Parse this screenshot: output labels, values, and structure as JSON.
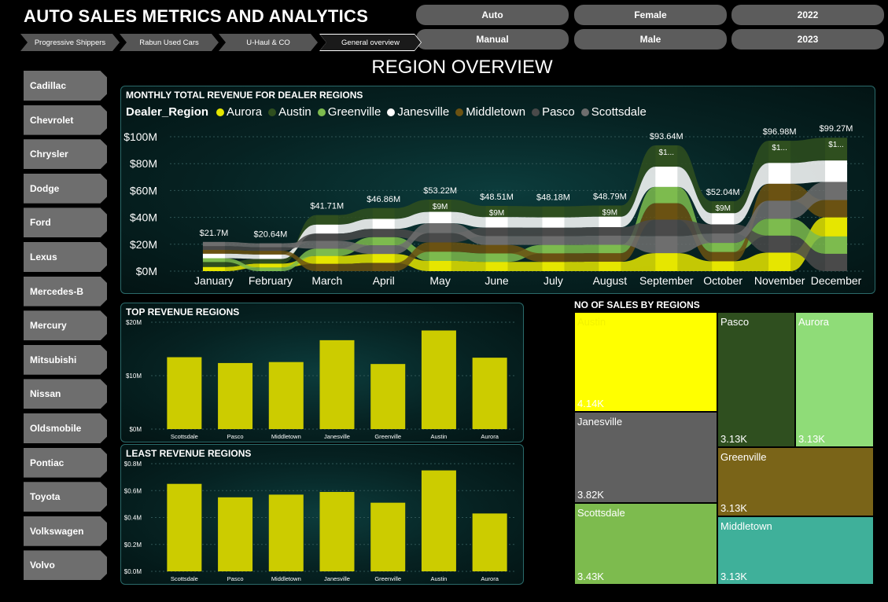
{
  "header": {
    "title": "AUTO SALES METRICS AND ANALYTICS",
    "section_title": "REGION OVERVIEW"
  },
  "filters": {
    "row1": [
      "Auto",
      "Female",
      "2022"
    ],
    "row2": [
      "Manual",
      "Male",
      "2023"
    ]
  },
  "breadcrumbs": [
    "Progressive Shippers",
    "Rabun Used Cars",
    "U-Haul & CO",
    "General overview"
  ],
  "brands": [
    "Cadillac",
    "Chevrolet",
    "Chrysler",
    "Dodge",
    "Ford",
    "Lexus",
    "Mercedes-B",
    "Mercury",
    "Mitsubishi",
    "Nissan",
    "Oldsmobile",
    "Pontiac",
    "Toyota",
    "Volkswagen",
    "Volvo"
  ],
  "colors": {
    "Aurora": "#e6e600",
    "Austin": "#2f4f1f",
    "Greenville": "#7dbb4e",
    "Janesville": "#ffffff",
    "Middletown": "#6b5212",
    "Pasco": "#4a4a4a",
    "Scottsdale": "#6e6e6e",
    "bar": "#cccc00"
  },
  "monthly_chart": {
    "title": "MONTHLY TOTAL REVENUE FOR DEALER REGIONS",
    "legend_title": "Dealer_Region",
    "chart_data": {
      "type": "area",
      "categories": [
        "January",
        "February",
        "March",
        "April",
        "May",
        "June",
        "July",
        "August",
        "September",
        "October",
        "November",
        "December"
      ],
      "totals": [
        21.7,
        20.64,
        41.71,
        46.86,
        53.22,
        48.51,
        48.18,
        48.79,
        93.64,
        52.04,
        96.98,
        99.27
      ],
      "total_labels": [
        "$21.7M",
        "$20.64M",
        "$41.71M",
        "$46.86M",
        "$53.22M",
        "$48.51M",
        "$48.18M",
        "$48.79M",
        "$93.64M",
        "$52.04M",
        "$96.98M",
        "$99.27M"
      ],
      "segment_labels": [
        "",
        "",
        "",
        "",
        "$9M",
        "$9M",
        "",
        "$9M",
        "$1...",
        "$9M",
        "$1...",
        "$1..."
      ],
      "y_ticks": [
        "$0M",
        "$20M",
        "$40M",
        "$60M",
        "$80M",
        "$100M"
      ],
      "ylim": [
        0,
        100
      ],
      "series": [
        {
          "name": "Aurora",
          "values": [
            3.1,
            2.9,
            5.9,
            6.7,
            7.6,
            6.9,
            6.9,
            7.0,
            13.4,
            7.4,
            13.8,
            14.2
          ]
        },
        {
          "name": "Austin",
          "values": [
            3.7,
            3.5,
            7.1,
            8.0,
            9.1,
            8.3,
            8.2,
            8.3,
            15.9,
            8.9,
            16.5,
            16.9
          ]
        },
        {
          "name": "Greenville",
          "values": [
            2.8,
            2.7,
            5.4,
            6.1,
            6.9,
            6.3,
            6.3,
            6.3,
            12.2,
            6.8,
            12.6,
            12.9
          ]
        },
        {
          "name": "Janesville",
          "values": [
            3.4,
            3.3,
            6.7,
            7.5,
            8.5,
            7.8,
            7.7,
            7.8,
            15.0,
            8.3,
            15.5,
            15.9
          ]
        },
        {
          "name": "Middletown",
          "values": [
            2.8,
            2.7,
            5.4,
            6.1,
            6.9,
            6.3,
            6.3,
            6.3,
            12.2,
            6.8,
            12.6,
            12.9
          ]
        },
        {
          "name": "Pasco",
          "values": [
            2.8,
            2.7,
            5.4,
            6.1,
            6.9,
            6.3,
            6.3,
            6.3,
            12.2,
            6.8,
            12.6,
            12.9
          ]
        },
        {
          "name": "Scottsdale",
          "values": [
            3.1,
            2.9,
            5.8,
            6.4,
            7.3,
            6.6,
            6.5,
            6.8,
            12.7,
            7.0,
            13.4,
            13.5
          ]
        }
      ]
    }
  },
  "top_chart": {
    "title": "TOP REVENUE REGIONS",
    "chart_data": {
      "type": "bar",
      "categories": [
        "Scottsdale",
        "Pasco",
        "Middletown",
        "Janesville",
        "Greenville",
        "Austin",
        "Aurora"
      ],
      "values": [
        14.8,
        13.6,
        13.8,
        18.3,
        13.4,
        20.3,
        14.7
      ],
      "y_ticks": [
        "$0M",
        "$10M",
        "$20M"
      ],
      "ylim": [
        0,
        22
      ]
    }
  },
  "least_chart": {
    "title": "LEAST REVENUE REGIONS",
    "chart_data": {
      "type": "bar",
      "categories": [
        "Scottsdale",
        "Pasco",
        "Middletown",
        "Janesville",
        "Greenville",
        "Austin",
        "Aurora"
      ],
      "values": [
        0.65,
        0.55,
        0.57,
        0.59,
        0.51,
        0.75,
        0.43
      ],
      "y_ticks": [
        "$0.0M",
        "$0.2M",
        "$0.4M",
        "$0.6M",
        "$0.8M"
      ],
      "ylim": [
        0,
        0.8
      ]
    }
  },
  "treemap": {
    "title": "NO OF SALES BY REGIONS",
    "tiles": [
      {
        "name": "Austin",
        "value": "4.14K",
        "color": "#ffff00",
        "text_color": "#f2f200"
      },
      {
        "name": "Pasco",
        "value": "3.13K",
        "color": "#2f4f1f",
        "text_color": "#ffffff"
      },
      {
        "name": "Aurora",
        "value": "3.13K",
        "color": "#8fdc78",
        "text_color": "#ffffff"
      },
      {
        "name": "Janesville",
        "value": "3.82K",
        "color": "#606060",
        "text_color": "#ffffff"
      },
      {
        "name": "Greenville",
        "value": "3.13K",
        "color": "#7a6418",
        "text_color": "#ffffff"
      },
      {
        "name": "Scottsdale",
        "value": "3.43K",
        "color": "#7dbb4e",
        "text_color": "#ffffff"
      },
      {
        "name": "Middletown",
        "value": "3.13K",
        "color": "#3fb09a",
        "text_color": "#ffffff"
      }
    ]
  }
}
